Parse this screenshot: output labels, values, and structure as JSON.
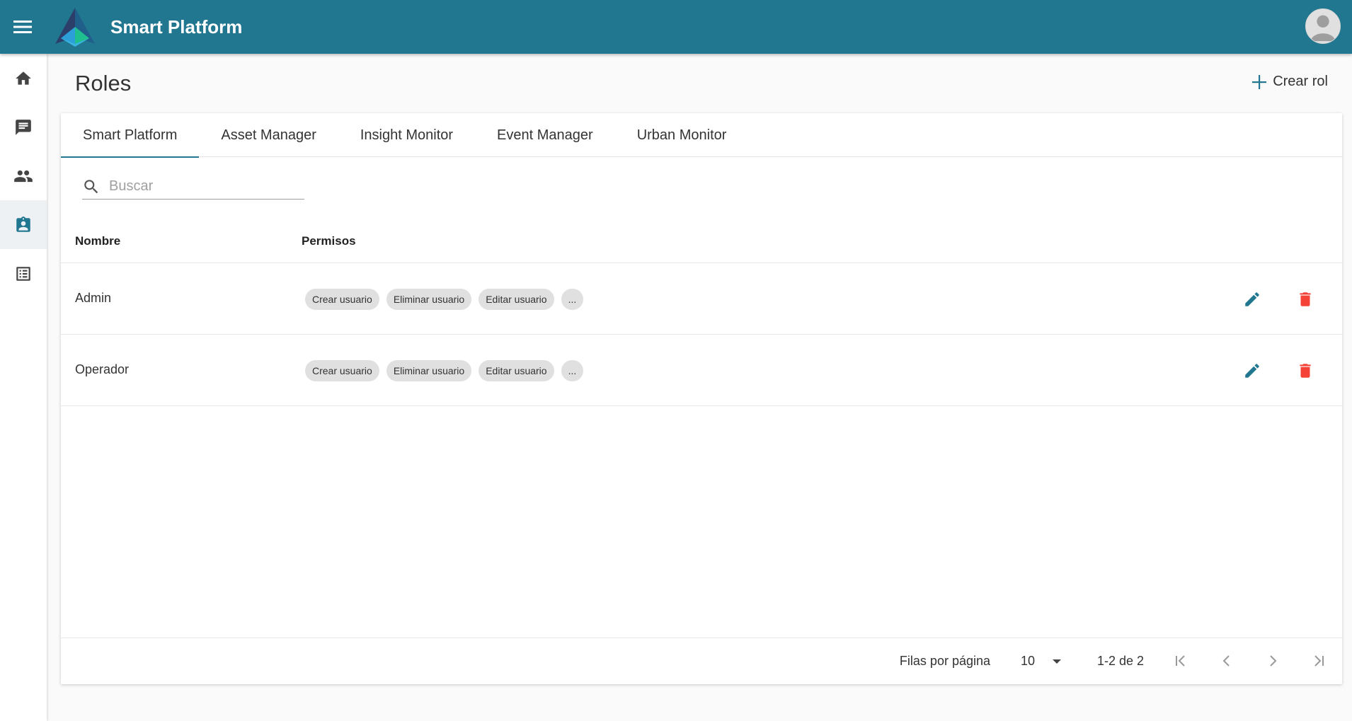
{
  "app": {
    "title": "Smart Platform"
  },
  "colors": {
    "primary": "#227790",
    "danger": "#f44336",
    "accent_icon": "#227790"
  },
  "sidebar": {
    "items": [
      {
        "icon": "home-icon",
        "active": false
      },
      {
        "icon": "chat-icon",
        "active": false
      },
      {
        "icon": "people-icon",
        "active": false
      },
      {
        "icon": "assignment-ind-icon",
        "active": true
      },
      {
        "icon": "list-icon",
        "active": false
      }
    ]
  },
  "page": {
    "title": "Roles",
    "create_label": "Crear rol"
  },
  "tabs": [
    {
      "label": "Smart Platform",
      "active": true
    },
    {
      "label": "Asset Manager",
      "active": false
    },
    {
      "label": "Insight Monitor",
      "active": false
    },
    {
      "label": "Event Manager",
      "active": false
    },
    {
      "label": "Urban Monitor",
      "active": false
    }
  ],
  "search": {
    "placeholder": "Buscar",
    "value": ""
  },
  "table": {
    "columns": [
      "Nombre",
      "Permisos"
    ],
    "rows": [
      {
        "name": "Admin",
        "permissions": [
          "Crear usuario",
          "Eliminar usuario",
          "Editar usuario",
          "..."
        ]
      },
      {
        "name": "Operador",
        "permissions": [
          "Crear usuario",
          "Eliminar usuario",
          "Editar usuario",
          "..."
        ]
      }
    ]
  },
  "pagination": {
    "rows_per_page_label": "Filas por página",
    "rows_per_page": "10",
    "range": "1-2 de 2"
  }
}
